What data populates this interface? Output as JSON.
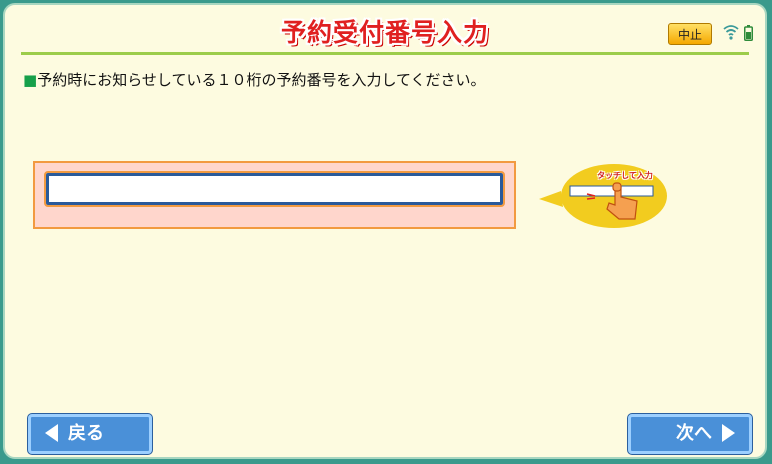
{
  "header": {
    "title": "予約受付番号入力",
    "cancel_label": "中止"
  },
  "status_icons": [
    "wifi-icon",
    "battery-icon"
  ],
  "instruction": {
    "marker": "■",
    "text": "予約時にお知らせしている１０桁の予約番号を入力してください。"
  },
  "reservation_input": {
    "value": "",
    "placeholder": ""
  },
  "hint": {
    "label": "タッチして入力",
    "icon": "touch-hand-icon"
  },
  "footer": {
    "back_label": "戻る",
    "next_label": "次へ"
  },
  "colors": {
    "title_red": "#e02020",
    "accent_green": "#9ccc4a",
    "button_blue": "#4a90d8",
    "panel_pink": "#ffd6cc",
    "panel_border_orange": "#f29a40",
    "hint_yellow": "#f2cc1f",
    "background_cream": "#fdfbe0"
  }
}
